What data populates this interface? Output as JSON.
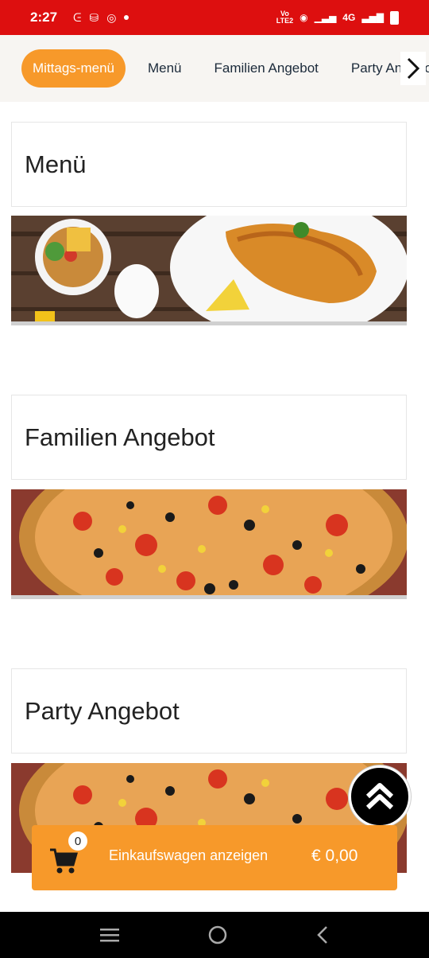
{
  "status": {
    "time": "2:27",
    "network": "4G"
  },
  "tabs": [
    "Mittags-menü",
    "Menü",
    "Familien Angebot",
    "Party Angebot"
  ],
  "sections": [
    {
      "title": "Menü",
      "image": "schnitzel-plate-image"
    },
    {
      "title": "Familien Angebot",
      "image": "pizza-image"
    },
    {
      "title": "Party Angebot",
      "image": "pizza-image"
    }
  ],
  "cart": {
    "count": "0",
    "label": "Einkaufswagen anzeigen",
    "total": "€ 0,00"
  },
  "colors": {
    "status_bar": "#dd0f0f",
    "accent": "#f7992a",
    "tab_bg": "#f7f5f2"
  }
}
